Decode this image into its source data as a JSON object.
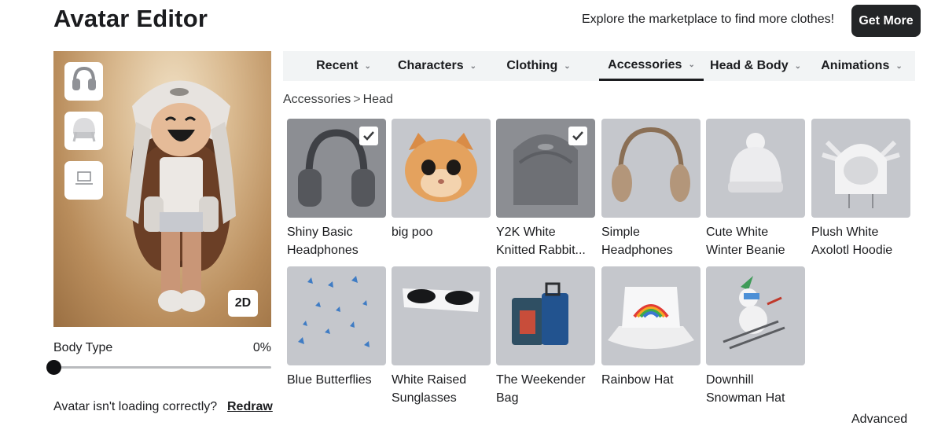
{
  "header": {
    "title": "Avatar Editor",
    "promo_text": "Explore the marketplace to find more clothes!",
    "get_more_label": "Get More"
  },
  "avatar": {
    "mode_label": "2D",
    "worn_icons": [
      "headphones-icon",
      "beanie-icon",
      "laptop-icon"
    ],
    "body_type_label": "Body Type",
    "body_type_value": "0%",
    "body_type_fraction": 0,
    "loading_message": "Avatar isn't loading correctly?",
    "redraw_label": "Redraw"
  },
  "tabs": [
    {
      "label": "Recent",
      "active": false
    },
    {
      "label": "Characters",
      "active": false
    },
    {
      "label": "Clothing",
      "active": false
    },
    {
      "label": "Accessories",
      "active": true
    },
    {
      "label": "Head & Body",
      "active": false
    },
    {
      "label": "Animations",
      "active": false
    }
  ],
  "breadcrumb": {
    "parent": "Accessories",
    "separator": ">",
    "current": "Head"
  },
  "items": [
    {
      "name": "Shiny Basic Headphones",
      "selected": true,
      "icon": "headphones-icon"
    },
    {
      "name": "big poo",
      "selected": false,
      "icon": "cat-head-icon"
    },
    {
      "name": "Y2K White Knitted Rabbit...",
      "selected": true,
      "icon": "knit-hood-icon"
    },
    {
      "name": "Simple Headphones",
      "selected": false,
      "icon": "headphones-icon"
    },
    {
      "name": "Cute White Winter Beanie",
      "selected": false,
      "icon": "beanie-icon"
    },
    {
      "name": "Plush White Axolotl Hoodie",
      "selected": false,
      "icon": "axolotl-hood-icon"
    },
    {
      "name": "Blue Butterflies",
      "selected": false,
      "icon": "butterflies-icon"
    },
    {
      "name": "White Raised Sunglasses",
      "selected": false,
      "icon": "sunglasses-icon"
    },
    {
      "name": "The Weekender Bag",
      "selected": false,
      "icon": "suitcase-icon"
    },
    {
      "name": "Rainbow Hat",
      "selected": false,
      "icon": "bucket-hat-icon"
    },
    {
      "name": "Downhill Snowman Hat",
      "selected": false,
      "icon": "snowman-skier-icon"
    }
  ],
  "footer": {
    "advanced_label": "Advanced"
  }
}
